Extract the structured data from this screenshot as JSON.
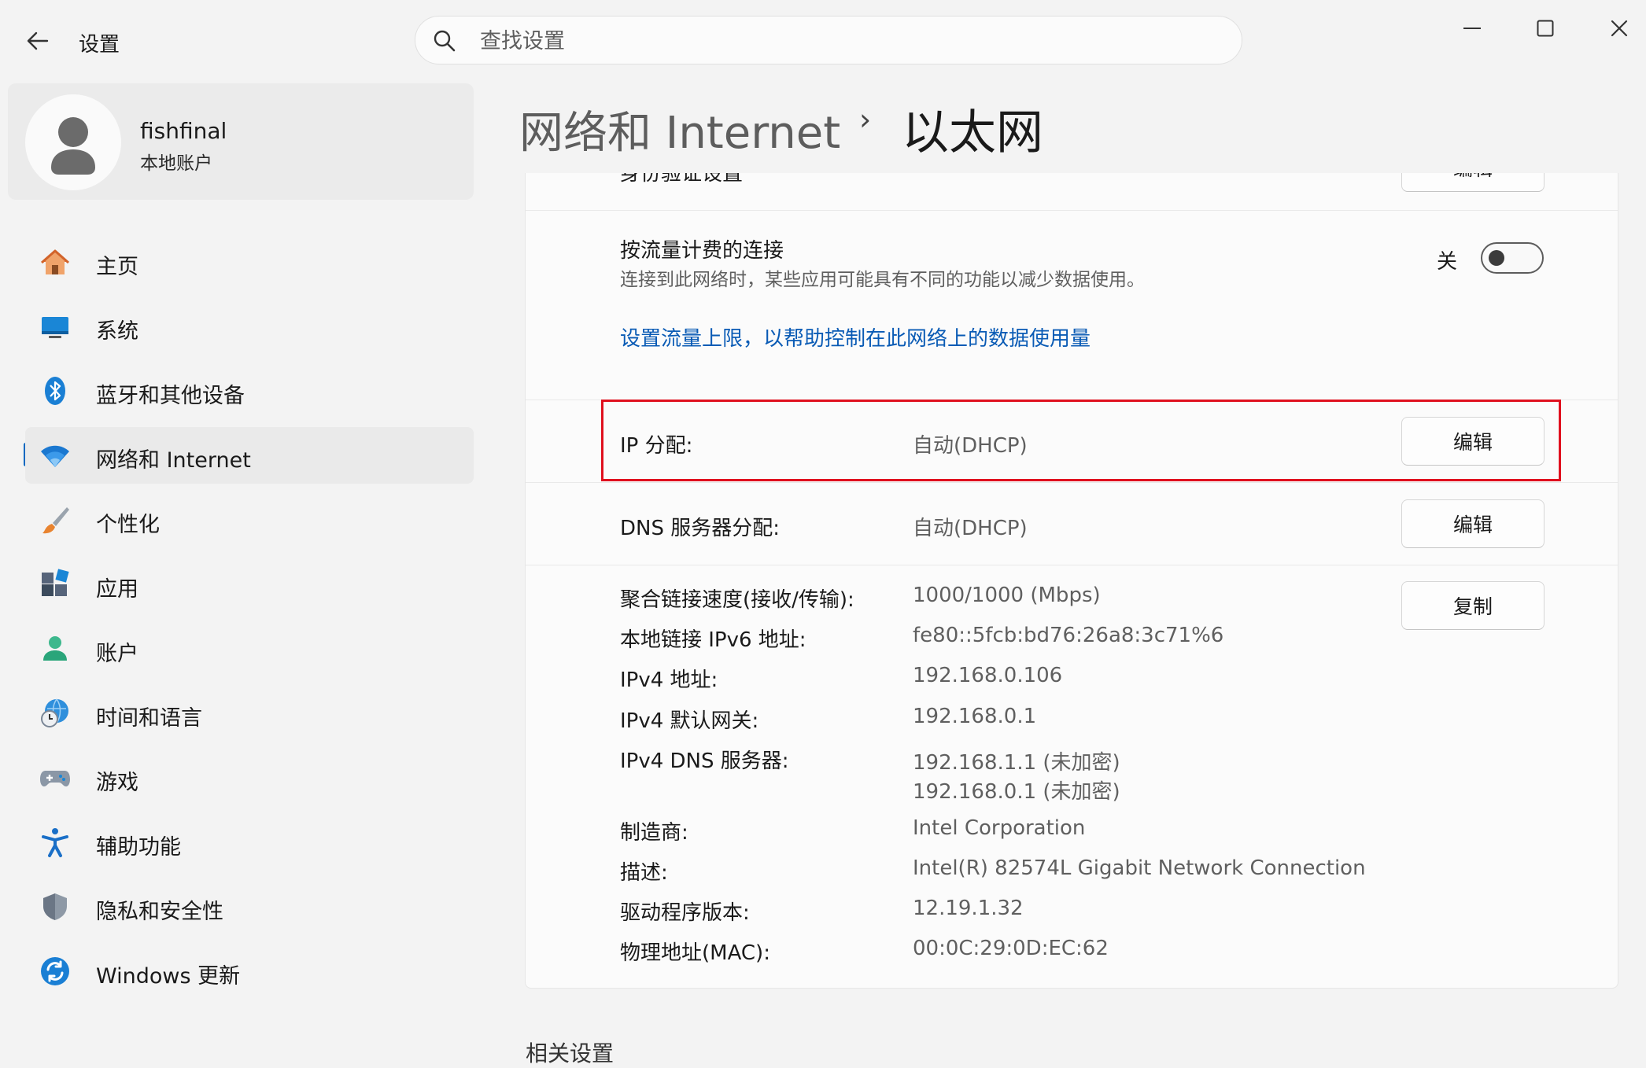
{
  "window": {
    "title": "设置"
  },
  "search": {
    "placeholder": "查找设置"
  },
  "profile": {
    "name": "fishfinal",
    "account_type": "本地账户"
  },
  "sidebar": {
    "items": [
      {
        "label": "主页",
        "icon": "home-icon"
      },
      {
        "label": "系统",
        "icon": "system-icon"
      },
      {
        "label": "蓝牙和其他设备",
        "icon": "bluetooth-icon"
      },
      {
        "label": "网络和 Internet",
        "icon": "wifi-icon",
        "active": true
      },
      {
        "label": "个性化",
        "icon": "brush-icon"
      },
      {
        "label": "应用",
        "icon": "apps-icon"
      },
      {
        "label": "账户",
        "icon": "account-icon"
      },
      {
        "label": "时间和语言",
        "icon": "time-language-icon"
      },
      {
        "label": "游戏",
        "icon": "gamepad-icon"
      },
      {
        "label": "辅助功能",
        "icon": "accessibility-icon"
      },
      {
        "label": "隐私和安全性",
        "icon": "shield-icon"
      },
      {
        "label": "Windows 更新",
        "icon": "windows-update-icon"
      }
    ]
  },
  "breadcrumb": {
    "parent": "网络和 Internet",
    "separator": "›",
    "current": "以太网"
  },
  "content": {
    "auth_settings_partial": "身份验证设置",
    "auth_edit_partial": "编辑",
    "metered": {
      "title": "按流量计费的连接",
      "description": "连接到此网络时，某些应用可能具有不同的功能以减少数据使用。",
      "state_label": "关",
      "enabled": false,
      "link": "设置流量上限，以帮助控制在此网络上的数据使用量"
    },
    "ip_assignment": {
      "label": "IP 分配:",
      "value": "自动(DHCP)",
      "button": "编辑"
    },
    "dns_assignment": {
      "label": "DNS 服务器分配:",
      "value": "自动(DHCP)",
      "button": "编辑"
    },
    "copy_button": "复制",
    "properties": [
      {
        "label": "聚合链接速度(接收/传输):",
        "value": "1000/1000 (Mbps)"
      },
      {
        "label": "本地链接 IPv6 地址:",
        "value": "fe80::5fcb:bd76:26a8:3c71%6"
      },
      {
        "label": "IPv4 地址:",
        "value": "192.168.0.106"
      },
      {
        "label": "IPv4 默认网关:",
        "value": "192.168.0.1"
      },
      {
        "label": "IPv4 DNS 服务器:",
        "value": "192.168.1.1 (未加密)",
        "value2": "192.168.0.1 (未加密)"
      },
      {
        "label": "制造商:",
        "value": "Intel Corporation"
      },
      {
        "label": "描述:",
        "value": "Intel(R) 82574L Gigabit Network Connection"
      },
      {
        "label": "驱动程序版本:",
        "value": "12.19.1.32"
      },
      {
        "label": "物理地址(MAC):",
        "value": "00:0C:29:0D:EC:62"
      }
    ]
  },
  "footer_partial": "相关设置",
  "colors": {
    "accent": "#0067c0",
    "highlight": "#e0101e",
    "link": "#0a5bb5"
  }
}
